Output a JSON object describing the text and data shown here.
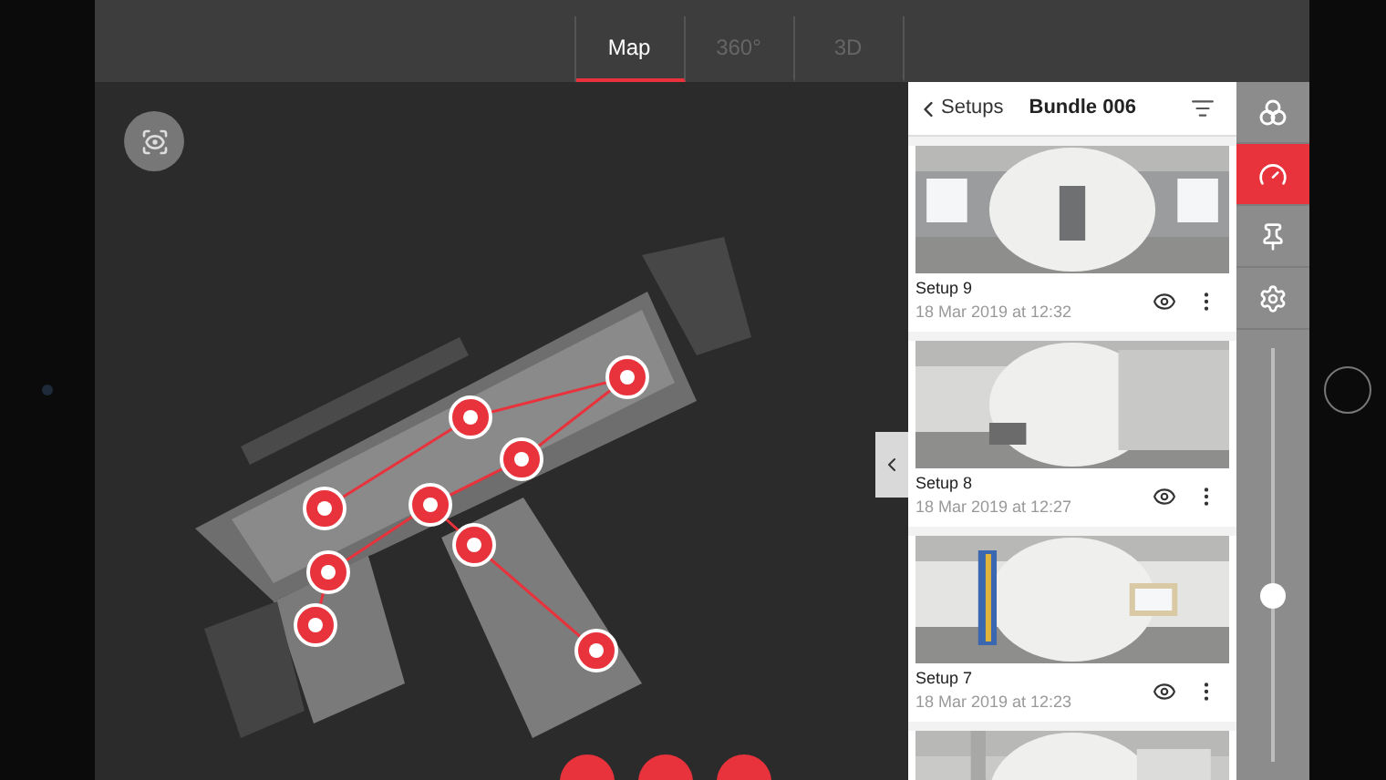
{
  "tabs": [
    {
      "label": "Map",
      "selected": true
    },
    {
      "label": "360°",
      "selected": false
    },
    {
      "label": "3D",
      "selected": false
    }
  ],
  "panel": {
    "back_label": "Setups",
    "title": "Bundle 006"
  },
  "setups": [
    {
      "kind": "setup",
      "name": "Setup 9",
      "date": "18 Mar 2019 at 12:32"
    },
    {
      "kind": "setup",
      "name": "Setup 8",
      "date": "18 Mar 2019 at 12:27"
    },
    {
      "kind": "setup",
      "name": "Setup 7",
      "date": "18 Mar 2019 at 12:23"
    },
    {
      "kind": "picture"
    }
  ],
  "rail": [
    {
      "kind": "layers",
      "selected": false
    },
    {
      "kind": "gauge",
      "selected": true
    },
    {
      "kind": "pin",
      "selected": false
    },
    {
      "kind": "settings",
      "selected": false
    }
  ],
  "zoom_slider": {
    "level": 0.4
  }
}
